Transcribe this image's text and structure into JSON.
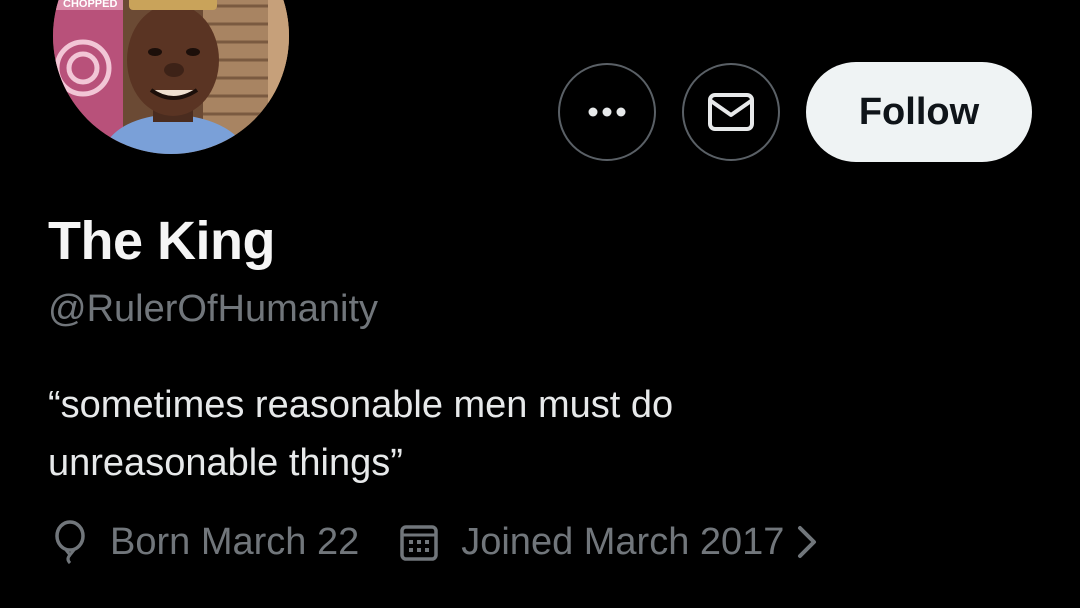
{
  "profile": {
    "display_name": "The King",
    "handle": "@RulerOfHumanity",
    "bio_line1": "“sometimes reasonable men must do",
    "bio_line2": "unreasonable things”",
    "birthday": "Born March 22",
    "joined": "Joined March 2017",
    "avatar_sign_text": "CHOPPED"
  },
  "actions": {
    "follow_label": "Follow"
  },
  "icons": {
    "more": "more-icon",
    "message": "envelope-icon",
    "birthday": "balloon-icon",
    "joined": "calendar-icon",
    "chevron": "chevron-right-icon"
  },
  "colors": {
    "background": "#000000",
    "text_primary": "#e7e9ea",
    "text_secondary": "#71767b",
    "button_border": "#5a6066",
    "follow_bg": "#eff3f4",
    "follow_text": "#0f1419"
  }
}
